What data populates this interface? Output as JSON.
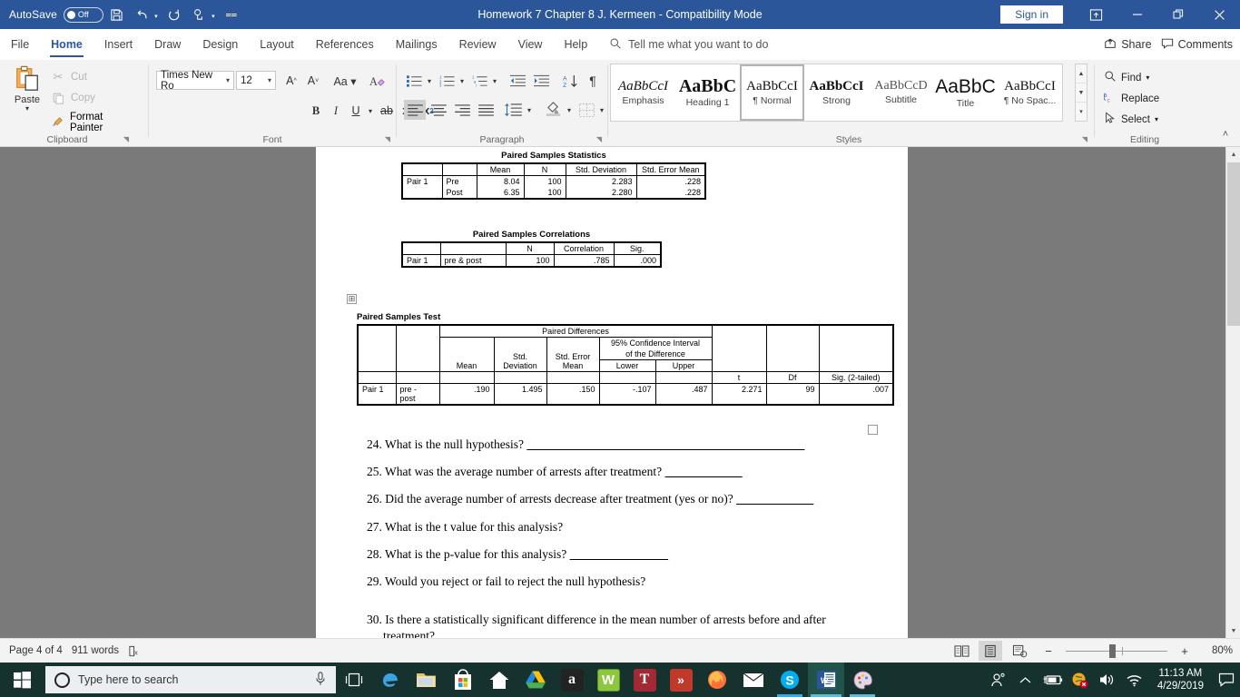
{
  "titlebar": {
    "autosave_label": "AutoSave",
    "autosave_state": "Off",
    "document_title": "Homework 7 Chapter 8 J. Kermeen  -  Compatibility Mode",
    "signin_label": "Sign in",
    "qat": [
      "save-icon",
      "undo-icon",
      "redo-icon",
      "touch-mode-icon",
      "customize-qat-icon"
    ],
    "window_buttons": [
      "ribbon-display-options",
      "minimize",
      "restore",
      "close"
    ],
    "bg_color": "#2b579a"
  },
  "tabs": [
    {
      "label": "File",
      "active": false
    },
    {
      "label": "Home",
      "active": true
    },
    {
      "label": "Insert",
      "active": false
    },
    {
      "label": "Draw",
      "active": false
    },
    {
      "label": "Design",
      "active": false
    },
    {
      "label": "Layout",
      "active": false
    },
    {
      "label": "References",
      "active": false
    },
    {
      "label": "Mailings",
      "active": false
    },
    {
      "label": "Review",
      "active": false
    },
    {
      "label": "View",
      "active": false
    },
    {
      "label": "Help",
      "active": false
    }
  ],
  "tellme": {
    "placeholder": "Tell me what you want to do"
  },
  "tabbar_right": [
    {
      "label": "Share",
      "icon": "share-icon"
    },
    {
      "label": "Comments",
      "icon": "comments-icon"
    }
  ],
  "ribbon": {
    "clipboard": {
      "group_label": "Clipboard",
      "paste_label": "Paste",
      "items": [
        {
          "label": "Cut",
          "icon": "scissors-icon",
          "disabled": true
        },
        {
          "label": "Copy",
          "icon": "copy-icon",
          "disabled": true
        },
        {
          "label": "Format Painter",
          "icon": "format-painter-icon",
          "disabled": false
        }
      ]
    },
    "font": {
      "group_label": "Font",
      "font_name": "Times New Ro",
      "font_size": "12",
      "buttons_row1": [
        "grow-font-icon",
        "shrink-font-icon",
        "change-case-icon",
        "clear-formatting-icon"
      ],
      "buttons_row2": [
        "bold-icon",
        "italic-icon",
        "underline-icon",
        "strikethrough-icon",
        "subscript-icon",
        "superscript-icon",
        "text-effects-icon",
        "highlight-icon",
        "font-color-icon"
      ]
    },
    "paragraph": {
      "group_label": "Paragraph",
      "buttons_row1": [
        "bullets-icon",
        "numbering-icon",
        "multilevel-list-icon",
        "decrease-indent-icon",
        "increase-indent-icon",
        "sort-icon",
        "show-marks-icon"
      ],
      "buttons_row2": [
        "align-left-icon",
        "align-center-icon",
        "align-right-icon",
        "justify-icon",
        "line-spacing-icon",
        "shading-icon",
        "borders-icon"
      ]
    },
    "styles": {
      "group_label": "Styles",
      "gallery": [
        {
          "preview": "AaBbCcI",
          "name": "Emphasis",
          "style": "italic-serif",
          "selected": false
        },
        {
          "preview": "AaBbC",
          "name": "Heading 1",
          "style": "bold-large",
          "selected": false
        },
        {
          "preview": "AaBbCcI",
          "name": "¶ Normal",
          "style": "plain",
          "selected": true
        },
        {
          "preview": "AaBbCcI",
          "name": "Strong",
          "style": "bold",
          "selected": false
        },
        {
          "preview": "AaBbCcD",
          "name": "Subtitle",
          "style": "plain-light",
          "selected": false
        },
        {
          "preview": "AaBbC",
          "name": "Title",
          "style": "title",
          "selected": false
        },
        {
          "preview": "AaBbCcI",
          "name": "¶ No Spac...",
          "style": "plain",
          "selected": false
        }
      ]
    },
    "editing": {
      "group_label": "Editing",
      "items": [
        {
          "label": "Find",
          "icon": "search-icon",
          "caret": true
        },
        {
          "label": "Replace",
          "icon": "replace-icon",
          "caret": false
        },
        {
          "label": "Select",
          "icon": "cursor-select-icon",
          "caret": true
        }
      ]
    },
    "collapse_ribbon_icon": "chevron-up-icon"
  },
  "document": {
    "tables": [
      {
        "title": "Paired Samples Statistics",
        "columns": [
          "",
          "",
          "Mean",
          "N",
          "Std. Deviation",
          "Std. Error Mean"
        ],
        "rows": [
          [
            "Pair 1",
            "Pre",
            "8.04",
            "100",
            "2.283",
            ".228"
          ],
          [
            "",
            "Post",
            "6.35",
            "100",
            "2.280",
            ".228"
          ]
        ]
      },
      {
        "title": "Paired Samples Correlations",
        "columns": [
          "",
          "",
          "N",
          "Correlation",
          "Sig."
        ],
        "rows": [
          [
            "Pair 1",
            "pre & post",
            "100",
            ".785",
            ".000"
          ]
        ]
      },
      {
        "title": "Paired Samples Test",
        "supergroup": "Paired Differences",
        "ci_header_line1": "95% Confidence Interval",
        "ci_header_line2": "of the Difference",
        "columns": [
          "Mean",
          "Std. Deviation",
          "Std. Error Mean",
          "Lower",
          "Upper",
          "t",
          "Df",
          "Sig. (2-tailed)"
        ],
        "rows": [
          [
            "Pair 1",
            "pre - post",
            ".190",
            "1.495",
            ".150",
            "-.107",
            ".487",
            "2.271",
            "99",
            ".007"
          ]
        ]
      }
    ],
    "questions": [
      {
        "number": "24.",
        "text": "What is the null hypothesis?",
        "blank_width": 350
      },
      {
        "number": "25.",
        "text": "What was the average number of arrests after treatment?",
        "blank_width": 102
      },
      {
        "number": "26.",
        "text": "Did the average number of arrests decrease after treatment (yes or no)?",
        "blank_width": 103
      },
      {
        "number": "27.",
        "text": "What is the t value for this analysis?",
        "blank_width": 0
      },
      {
        "number": "28.",
        "text": "What is the p-value for this analysis?",
        "blank_width": 131
      },
      {
        "number": "29.",
        "text": "Would you reject or fail to reject the null hypothesis?",
        "blank_width": 0
      },
      {
        "number": "30.",
        "text": "Is there a statistically significant difference in the mean number of arrests before and after",
        "blank_width": 0,
        "text_line2": "treatment?"
      }
    ]
  },
  "statusbar": {
    "page_info": "Page 4 of 4",
    "word_count": "911 words",
    "proofing_icon": "proofing-errors-icon",
    "views": [
      {
        "icon": "read-mode-icon",
        "active": false
      },
      {
        "icon": "print-layout-icon",
        "active": true
      },
      {
        "icon": "web-layout-icon",
        "active": false
      }
    ],
    "zoom_out_icon": "minus-icon",
    "zoom_in_icon": "plus-icon",
    "zoom_level": "80%"
  },
  "taskbar": {
    "start_icon": "windows-logo-icon",
    "search_placeholder": "Type here to search",
    "cortana_icon": "cortana-circle-icon",
    "mic_icon": "microphone-icon",
    "taskview_icon": "task-view-icon",
    "apps": [
      {
        "name": "edge-icon",
        "glyph": "e",
        "bg": "transparent",
        "color": "#3aa3e3",
        "running": false
      },
      {
        "name": "file-explorer-icon",
        "glyph": "🗀",
        "bg": "transparent",
        "color": "#e8c16a",
        "running": false
      },
      {
        "name": "microsoft-store-icon",
        "glyph": "",
        "bg": "#ffffff",
        "color": "#0078d7",
        "running": false
      },
      {
        "name": "home-icon",
        "glyph": "⌂",
        "bg": "transparent",
        "color": "#ffffff",
        "running": false
      },
      {
        "name": "google-drive-icon",
        "glyph": "",
        "bg": "transparent",
        "color": "#34a853",
        "running": false
      },
      {
        "name": "amazon-icon",
        "glyph": "a",
        "bg": "#232323",
        "color": "#ffffff",
        "running": false
      },
      {
        "name": "wolfram-icon",
        "glyph": "W",
        "bg": "#7fbf4d",
        "color": "#ffffff",
        "running": false
      },
      {
        "name": "turnitin-icon",
        "glyph": "T",
        "bg": "#a32a34",
        "color": "#ffffff",
        "running": false
      },
      {
        "name": "rss-reader-icon",
        "glyph": "»",
        "bg": "#c0392b",
        "color": "#ffffff",
        "running": false
      },
      {
        "name": "firefox-icon",
        "glyph": "",
        "bg": "transparent",
        "color": "#ff8a2b",
        "running": false
      },
      {
        "name": "mail-icon",
        "glyph": "✉",
        "bg": "transparent",
        "color": "#ffffff",
        "running": false
      },
      {
        "name": "skype-icon",
        "glyph": "S",
        "bg": "#00aff0",
        "color": "#ffffff",
        "running": true
      },
      {
        "name": "word-icon",
        "glyph": "W",
        "bg": "#2b579a",
        "color": "#ffffff",
        "running": true,
        "active": true
      },
      {
        "name": "paint-icon",
        "glyph": "🎨",
        "bg": "transparent",
        "color": "#d4a3c8",
        "running": true
      }
    ],
    "tray": {
      "people_icon": "people-icon",
      "show_hidden_icon": "chevron-up-icon",
      "battery_icon": "battery-charging-icon",
      "antivirus_icon": "antivirus-alert-icon",
      "volume_icon": "speaker-icon",
      "wifi_icon": "wifi-icon",
      "time": "11:13 AM",
      "date": "4/29/2019",
      "action_center_icon": "notification-icon"
    },
    "bg_color": "#15322f"
  }
}
